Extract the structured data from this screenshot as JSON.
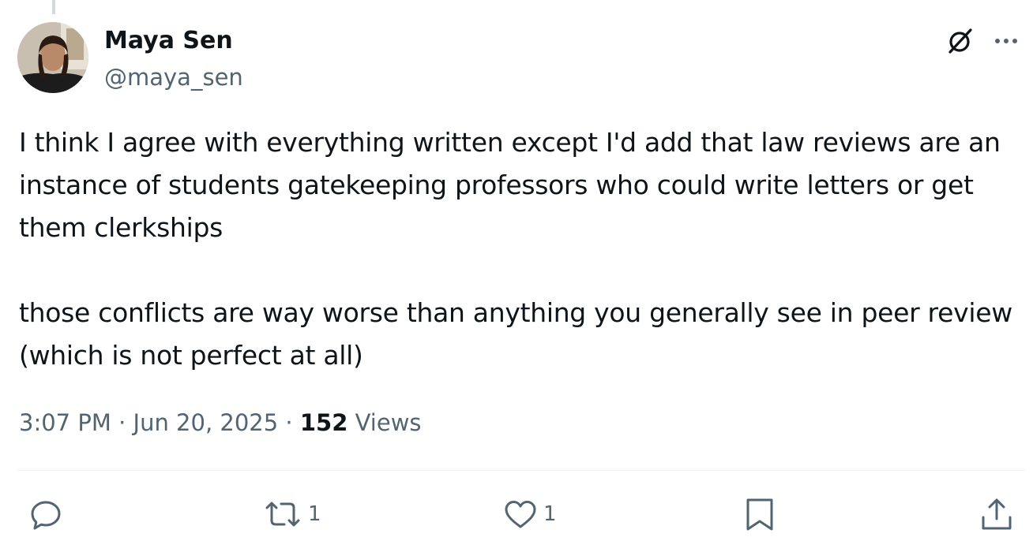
{
  "author": {
    "name": "Maya Sen",
    "handle": "@maya_sen"
  },
  "icons": {
    "grok": "grok-icon",
    "more": "more-icon",
    "reply": "reply-icon",
    "retweet": "retweet-icon",
    "like": "heart-icon",
    "bookmark": "bookmark-icon",
    "share": "share-icon"
  },
  "tweet": {
    "text": "I think I agree with everything written except I'd add that law reviews are an instance of students gatekeeping professors who could write letters or get them clerkships\n\nthose conflicts are way worse than anything you generally see in peer review (which is not perfect at all)",
    "time": "3:07 PM",
    "separator": "·",
    "date": "Jun 20, 2025",
    "views_count": "152",
    "views_label": "Views"
  },
  "actions": {
    "reply_count": "",
    "retweet_count": "1",
    "like_count": "1"
  },
  "colors": {
    "text_primary": "#0f1419",
    "text_secondary": "#536471",
    "divider": "#eff3f4"
  }
}
